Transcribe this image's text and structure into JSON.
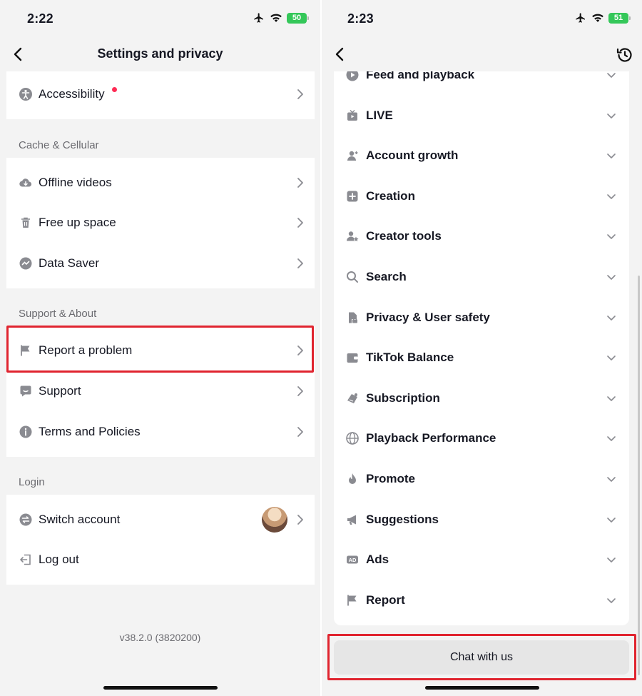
{
  "left": {
    "status_time": "2:22",
    "battery": "50",
    "title": "Settings and privacy",
    "top_item": {
      "label": "Accessibility",
      "icon": "accessibility-icon"
    },
    "sections": [
      {
        "header": "Cache & Cellular",
        "items": [
          {
            "label": "Offline videos",
            "icon": "cloud-download-icon"
          },
          {
            "label": "Free up space",
            "icon": "trash-icon"
          },
          {
            "label": "Data Saver",
            "icon": "data-saver-icon"
          }
        ]
      },
      {
        "header": "Support & About",
        "items": [
          {
            "label": "Report a problem",
            "icon": "flag-icon"
          },
          {
            "label": "Support",
            "icon": "chat-bubble-icon"
          },
          {
            "label": "Terms and Policies",
            "icon": "info-icon"
          }
        ]
      },
      {
        "header": "Login",
        "items": [
          {
            "label": "Switch account",
            "icon": "switch-icon"
          },
          {
            "label": "Log out",
            "icon": "logout-icon"
          }
        ]
      }
    ],
    "version": "v38.2.0 (3820200)"
  },
  "right": {
    "status_time": "2:23",
    "battery": "51",
    "topics": [
      {
        "label": "Feed and playback",
        "icon": "play-circle-icon"
      },
      {
        "label": "LIVE",
        "icon": "live-tv-icon"
      },
      {
        "label": "Account growth",
        "icon": "person-add-icon"
      },
      {
        "label": "Creation",
        "icon": "plus-square-icon"
      },
      {
        "label": "Creator tools",
        "icon": "person-star-icon"
      },
      {
        "label": "Search",
        "icon": "search-icon"
      },
      {
        "label": "Privacy & User safety",
        "icon": "privacy-icon"
      },
      {
        "label": "TikTok Balance",
        "icon": "wallet-icon"
      },
      {
        "label": "Subscription",
        "icon": "subscription-icon"
      },
      {
        "label": "Playback Performance",
        "icon": "globe-icon"
      },
      {
        "label": "Promote",
        "icon": "flame-icon"
      },
      {
        "label": "Suggestions",
        "icon": "megaphone-icon"
      },
      {
        "label": "Ads",
        "icon": "ad-icon"
      },
      {
        "label": "Report",
        "icon": "flag-icon"
      }
    ],
    "chat_button": "Chat with us"
  },
  "colors": {
    "highlight": "#e0242f",
    "notification_dot": "#fe2c55",
    "battery": "#34c759"
  }
}
